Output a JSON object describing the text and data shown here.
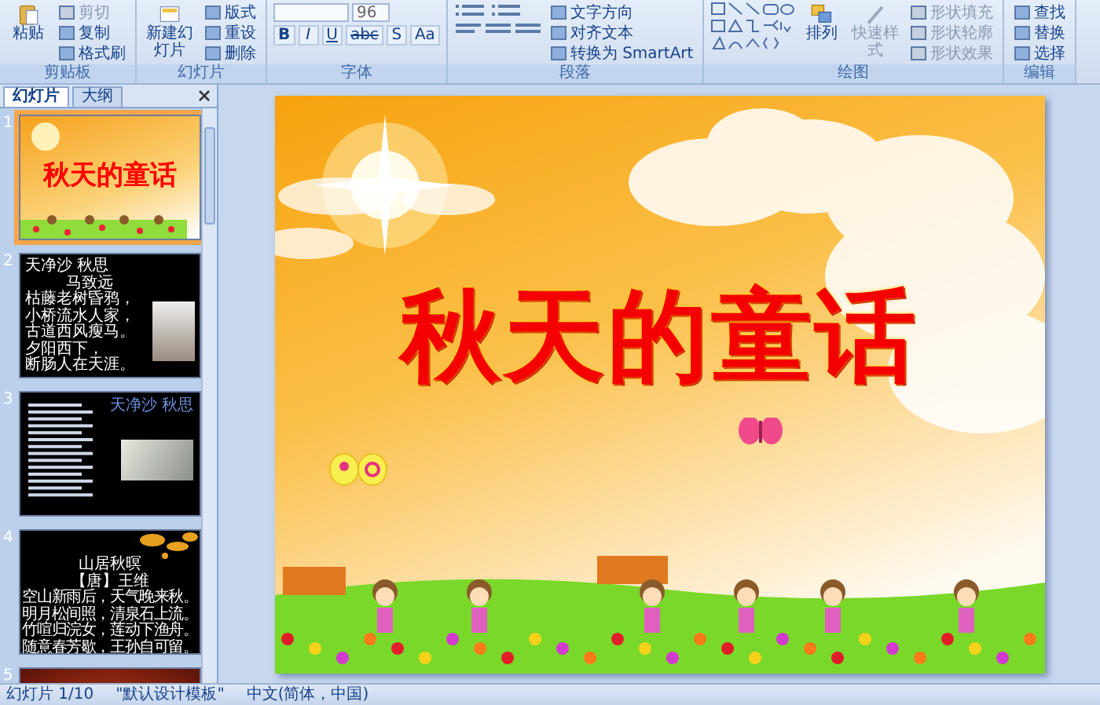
{
  "ribbon": {
    "groups": [
      {
        "kind": "clipboard",
        "label": "剪贴板",
        "large": [
          {
            "label": "粘贴",
            "disabled": false
          }
        ],
        "small": [
          {
            "label": "剪切",
            "disabled": true
          },
          {
            "label": "复制",
            "disabled": false
          },
          {
            "label": "格式刷",
            "disabled": false
          }
        ]
      },
      {
        "kind": "slides",
        "label": "幻灯片",
        "large": [
          {
            "label": "新建幻灯片",
            "disabled": false
          }
        ],
        "small": [
          {
            "label": "版式",
            "disabled": false
          },
          {
            "label": "重设",
            "disabled": false
          },
          {
            "label": "删除",
            "disabled": false
          }
        ]
      },
      {
        "kind": "font",
        "label": "字体",
        "font_size": "96",
        "format_buttons": [
          "B",
          "I",
          "U",
          "abc",
          "S",
          "Aa"
        ]
      },
      {
        "kind": "paragraph",
        "label": "段落",
        "small": [
          {
            "label": "文字方向",
            "disabled": false
          },
          {
            "label": "对齐文本",
            "disabled": false
          },
          {
            "label": "转换为 SmartArt",
            "disabled": false
          }
        ]
      },
      {
        "kind": "drawing",
        "label": "绘图",
        "large": [
          {
            "label": "排列",
            "disabled": false
          },
          {
            "label": "快速样式",
            "disabled": true
          }
        ],
        "small": [
          {
            "label": "形状填充",
            "disabled": true
          },
          {
            "label": "形状轮廓",
            "disabled": true
          },
          {
            "label": "形状效果",
            "disabled": true
          }
        ]
      },
      {
        "kind": "editing",
        "label": "编辑",
        "small": [
          {
            "label": "查找",
            "disabled": false
          },
          {
            "label": "替换",
            "disabled": false
          },
          {
            "label": "选择",
            "disabled": false
          }
        ]
      }
    ]
  },
  "panel": {
    "tabs": [
      {
        "label": "幻灯片",
        "selected": true
      },
      {
        "label": "大纲",
        "selected": false
      }
    ],
    "thumbnails": [
      {
        "number": "1",
        "selected": true,
        "kind": "title",
        "title": "秋天的童话"
      },
      {
        "number": "2",
        "selected": false,
        "kind": "poem",
        "title": "天净沙 秋思",
        "author": "马致远",
        "lines": [
          "枯藤老树昏鸦，",
          "小桥流水人家，",
          "古道西风瘦马。",
          "夕阳西下，",
          "断肠人在天涯。"
        ]
      },
      {
        "number": "3",
        "selected": false,
        "kind": "dense",
        "title": "天净沙 秋思"
      },
      {
        "number": "4",
        "selected": false,
        "kind": "centered",
        "title": "山居秋暝",
        "author": "【唐】王维",
        "lines": [
          "空山新雨后，天气晚来秋。",
          "明月松间照，清泉石上流。",
          "竹喧归浣女，莲动下渔舟。",
          "随意春芳歇，王孙自可留。"
        ]
      },
      {
        "number": "5",
        "selected": false,
        "kind": "photo"
      }
    ]
  },
  "slide": {
    "title": "秋天的童话"
  },
  "status_bar": {
    "items": [
      "幻灯片 1/10",
      "\"默认设计模板\"",
      "中文(简体，中国)"
    ]
  }
}
